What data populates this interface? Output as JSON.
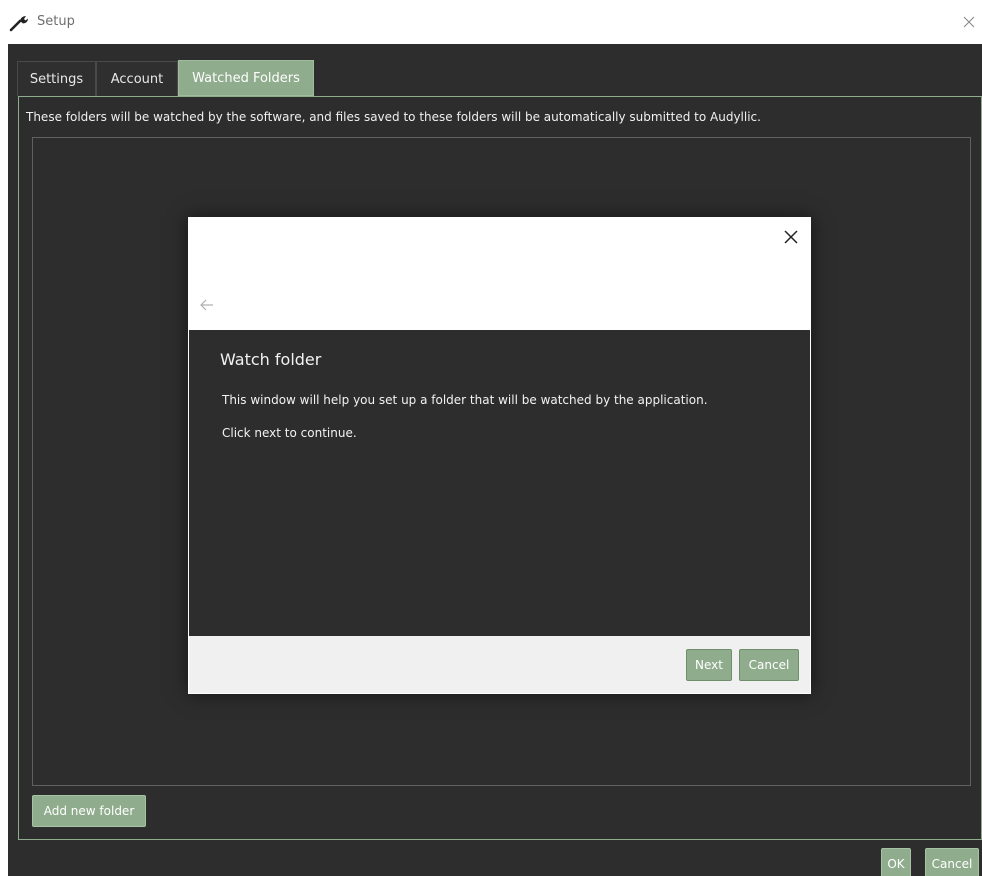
{
  "window": {
    "title": "Setup",
    "title_icon": "wrench-icon",
    "close_icon": "close-icon"
  },
  "tabs": [
    {
      "label": "Settings",
      "active": false
    },
    {
      "label": "Account",
      "active": false
    },
    {
      "label": "Watched Folders",
      "active": true
    }
  ],
  "watched_folders": {
    "description": "These folders will be watched by the software, and files saved to these folders will be automatically submitted to Audyllic.",
    "add_button_label": "Add new folder"
  },
  "dialog_buttons": {
    "ok_label": "OK",
    "cancel_label": "Cancel"
  },
  "wizard": {
    "heading": "Watch folder",
    "line1": "This window will help you set up a folder that will be watched by the application.",
    "line2": "Click next to continue.",
    "next_label": "Next",
    "cancel_label": "Cancel",
    "back_icon": "arrow-left-icon",
    "close_icon": "close-icon"
  },
  "colors": {
    "accent": "#8fac8d",
    "background": "#2d2d2d",
    "text": "#f0f0f0"
  }
}
